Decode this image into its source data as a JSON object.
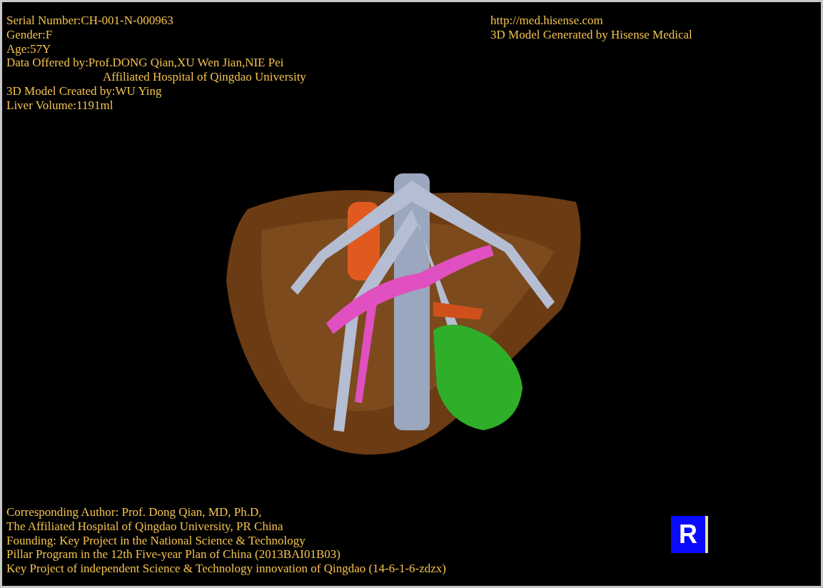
{
  "info_left": [
    {
      "text": "Serial Number:CH-001-N-000963",
      "kind": "plain"
    },
    {
      "text": "Gender:F",
      "kind": "plain"
    },
    {
      "text": "Age:57Y",
      "kind": "plain"
    },
    {
      "text": "Data Offered by:Prof.DONG Qian,XU Wen Jian,NIE Pei",
      "kind": "plain"
    },
    {
      "text": "Affiliated Hospital of Qingdao University",
      "kind": "indented"
    },
    {
      "text": "3D Model Created by:WU Ying",
      "kind": "plain"
    },
    {
      "text": "Liver Volume:1191ml",
      "kind": "plain"
    }
  ],
  "info_right": [
    "http://med.hisense.com",
    "3D Model Generated by Hisense Medical"
  ],
  "orientation_label": "R",
  "footer": [
    "Corresponding Author: Prof. Dong Qian, MD, Ph.D,",
    "The Affiliated Hospital of Qingdao University, PR China",
    "Founding: Key Project in the National Science & Technology",
    "Pillar Program in the 12th Five-year Plan of China (2013BAI01B03)",
    "Key Project of independent Science & Technology innovation of Qingdao (14-6-1-6-zdzx)"
  ]
}
